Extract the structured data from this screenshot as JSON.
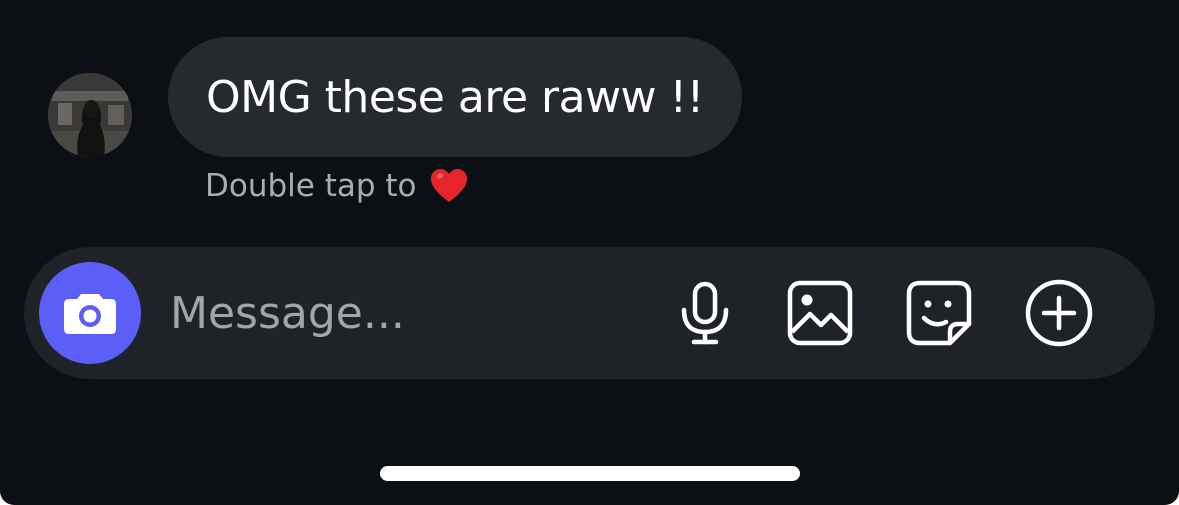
{
  "message": {
    "text": "OMG these are raww !!",
    "avatar_icon": "profile-photo"
  },
  "hint": {
    "text": "Double tap to",
    "emoji": "❤️",
    "emoji_icon": "red-heart-icon",
    "color": "#a8acb3"
  },
  "composer": {
    "placeholder": "Message...",
    "camera_icon": "camera-icon",
    "camera_color": "#5b5ef7",
    "tools": [
      {
        "icon": "microphone-icon"
      },
      {
        "icon": "gallery-icon"
      },
      {
        "icon": "sticker-icon"
      },
      {
        "icon": "plus-circle-icon"
      }
    ]
  },
  "colors": {
    "background": "#0c1014",
    "bubble": "#262a2f",
    "composer": "#1f2226"
  }
}
